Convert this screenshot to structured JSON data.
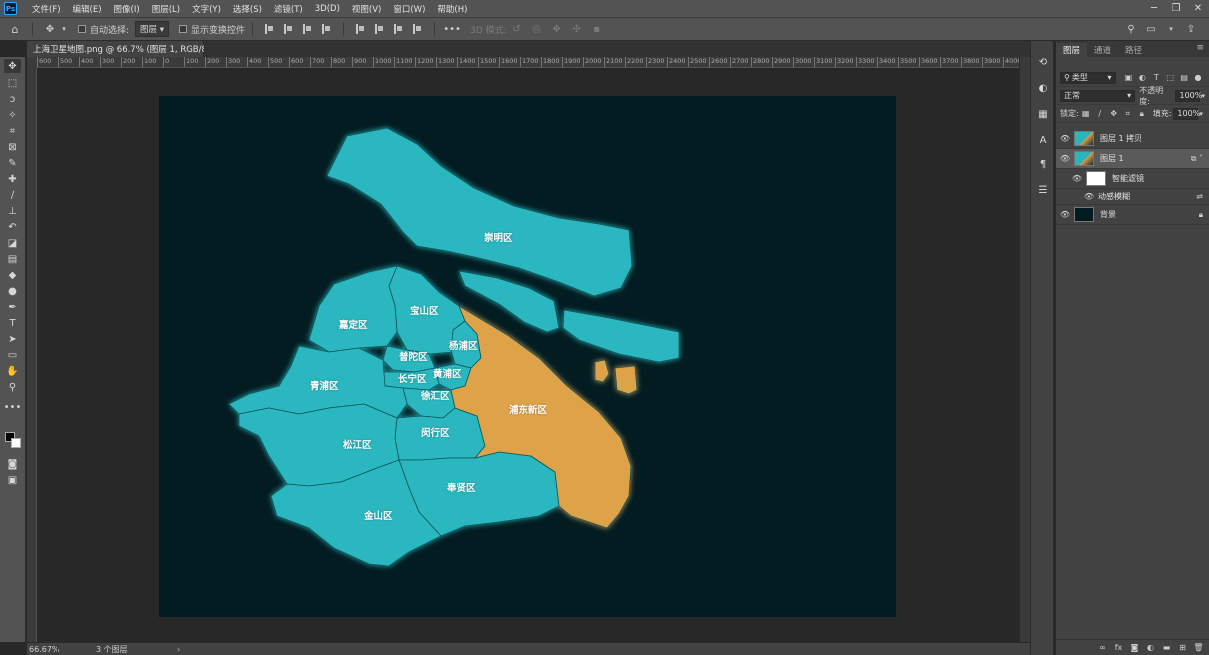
{
  "menu": [
    "文件(F)",
    "编辑(E)",
    "图像(I)",
    "图层(L)",
    "文字(Y)",
    "选择(S)",
    "滤镜(T)",
    "3D(D)",
    "视图(V)",
    "窗口(W)",
    "帮助(H)"
  ],
  "app_logo": "Ps",
  "options": {
    "auto_select_label": "自动选择:",
    "auto_select_value": "图层",
    "show_transform_label": "显示变换控件",
    "mode_3d_label": "3D 模式:"
  },
  "document": {
    "tab_title": "上海卫星地图.png @ 66.7% (图层 1, RGB/8) *",
    "zoom": "66.67%",
    "layer_count": "3 个图层"
  },
  "ruler": {
    "ticks": [
      "600",
      "500",
      "400",
      "300",
      "200",
      "100",
      "0",
      "100",
      "200",
      "300",
      "400",
      "500",
      "600",
      "700",
      "800",
      "900",
      "1000",
      "1100",
      "1200",
      "1300",
      "1400",
      "1500",
      "1600",
      "1700",
      "1800",
      "1900",
      "2000",
      "2100",
      "2200",
      "2300",
      "2400",
      "2500",
      "2600",
      "2700",
      "2800",
      "2900",
      "3000",
      "3100",
      "3200",
      "3300",
      "3400",
      "3500",
      "3600",
      "3700",
      "3800",
      "3900",
      "4000"
    ]
  },
  "map": {
    "colors": {
      "normal": "#29b7bf",
      "highlight": "#dea34a",
      "background": "#021c21",
      "border": "#0f5458"
    },
    "districts": {
      "chongming": "崇明区",
      "baoshan": "宝山区",
      "jiading": "嘉定区",
      "putuo": "普陀区",
      "yangpu": "杨浦区",
      "changning": "长宁区",
      "huangpu": "黄浦区",
      "qingpu": "青浦区",
      "xuhui": "徐汇区",
      "pudong": "浦东新区",
      "songjiang": "松江区",
      "minhang": "闵行区",
      "fengxian": "奉贤区",
      "jinshan": "金山区"
    }
  },
  "panel": {
    "tabs": [
      "图层",
      "通道",
      "路径"
    ],
    "filter_kind": "类型",
    "blend_mode": "正常",
    "opacity_label": "不透明度:",
    "opacity_value": "100%",
    "lock_label": "锁定:",
    "fill_label": "填充:",
    "fill_value": "100%",
    "layers": [
      {
        "name": "图层 1 拷贝"
      },
      {
        "name": "图层 1"
      },
      {
        "name": "智能滤镜"
      },
      {
        "name": "动感模糊"
      },
      {
        "name": "背景"
      }
    ]
  }
}
